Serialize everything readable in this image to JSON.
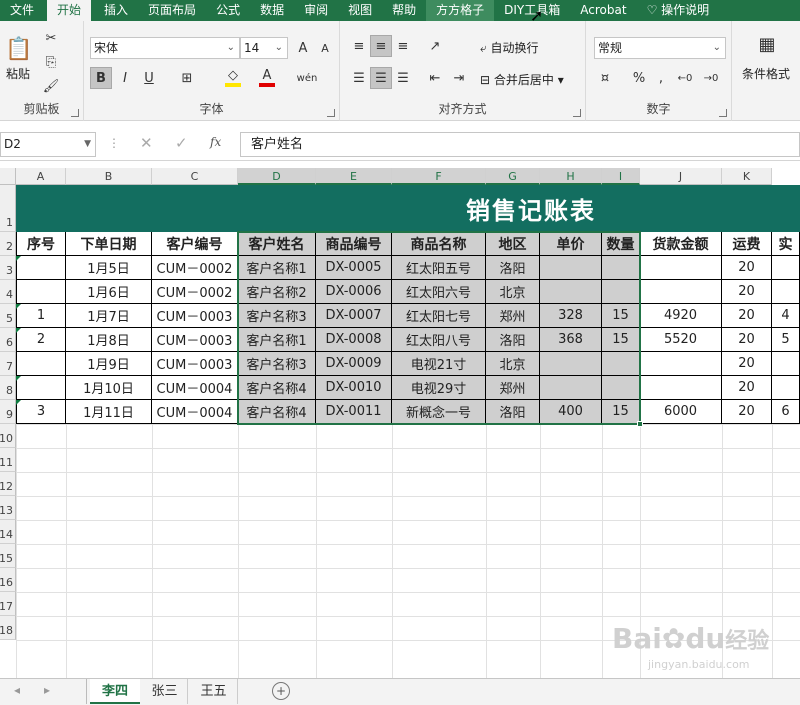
{
  "menu": {
    "tabs": [
      "文件",
      "开始",
      "插入",
      "页面布局",
      "公式",
      "数据",
      "审阅",
      "视图",
      "帮助",
      "方方格子",
      "DIY工具箱",
      "Acrobat",
      "操作说明"
    ],
    "active_index": 1
  },
  "ribbon": {
    "clipboard": {
      "label": "剪贴板",
      "paste": "粘贴"
    },
    "font": {
      "label": "字体",
      "name": "宋体",
      "size": "14",
      "bold": "B",
      "italic": "I",
      "underline": "U",
      "grow": "A",
      "shrink": "A",
      "wen": "wén",
      "font_color_icon": "A",
      "fill_color": "#ffe600",
      "font_color": "#e00000"
    },
    "alignment": {
      "label": "对齐方式",
      "wrap": "自动换行",
      "merge": "合并后居中"
    },
    "number": {
      "label": "数字",
      "format": "常规",
      "percent": "%",
      "comma": ","
    },
    "styles": {
      "cond": "条件格式"
    }
  },
  "formula_bar": {
    "name_box": "D2",
    "fx": "fx",
    "value": "客户姓名"
  },
  "columns": [
    "A",
    "B",
    "C",
    "D",
    "E",
    "F",
    "G",
    "H",
    "I",
    "J",
    "K"
  ],
  "rows": [
    "1",
    "2",
    "3",
    "4",
    "5",
    "6",
    "7",
    "8",
    "9",
    "10",
    "11",
    "12",
    "13",
    "14",
    "15",
    "16",
    "17",
    "18"
  ],
  "title": "销售记账表",
  "headers": [
    "序号",
    "下单日期",
    "客户编号",
    "客户姓名",
    "商品编号",
    "商品名称",
    "地区",
    "单价",
    "数量",
    "货款金额",
    "运费",
    "实"
  ],
  "data": [
    [
      "",
      "1月5日",
      "CUM－0002",
      "客户名称1",
      "DX-0005",
      "红太阳五号",
      "洛阳",
      "",
      "",
      "",
      "20",
      ""
    ],
    [
      "",
      "1月6日",
      "CUM－0002",
      "客户名称2",
      "DX-0006",
      "红太阳六号",
      "北京",
      "",
      "",
      "",
      "20",
      ""
    ],
    [
      "1",
      "1月7日",
      "CUM－0003",
      "客户名称3",
      "DX-0007",
      "红太阳七号",
      "郑州",
      "328",
      "15",
      "4920",
      "20",
      "4"
    ],
    [
      "2",
      "1月8日",
      "CUM－0003",
      "客户名称1",
      "DX-0008",
      "红太阳八号",
      "洛阳",
      "368",
      "15",
      "5520",
      "20",
      "5"
    ],
    [
      "",
      "1月9日",
      "CUM－0003",
      "客户名称3",
      "DX-0009",
      "电视21寸",
      "北京",
      "",
      "",
      "",
      "20",
      ""
    ],
    [
      "",
      "1月10日",
      "CUM－0004",
      "客户名称4",
      "DX-0010",
      "电视29寸",
      "郑州",
      "",
      "",
      "",
      "20",
      ""
    ],
    [
      "3",
      "1月11日",
      "CUM－0004",
      "客户名称4",
      "DX-0011",
      "新概念一号",
      "洛阳",
      "400",
      "15",
      "6000",
      "20",
      "6"
    ]
  ],
  "sheets": [
    "李四",
    "张三",
    "王五"
  ],
  "active_sheet": 0,
  "watermark": {
    "brand": "Bai",
    "brand2": "du",
    "suffix": "经验",
    "url": "jingyan.baidu.com"
  }
}
